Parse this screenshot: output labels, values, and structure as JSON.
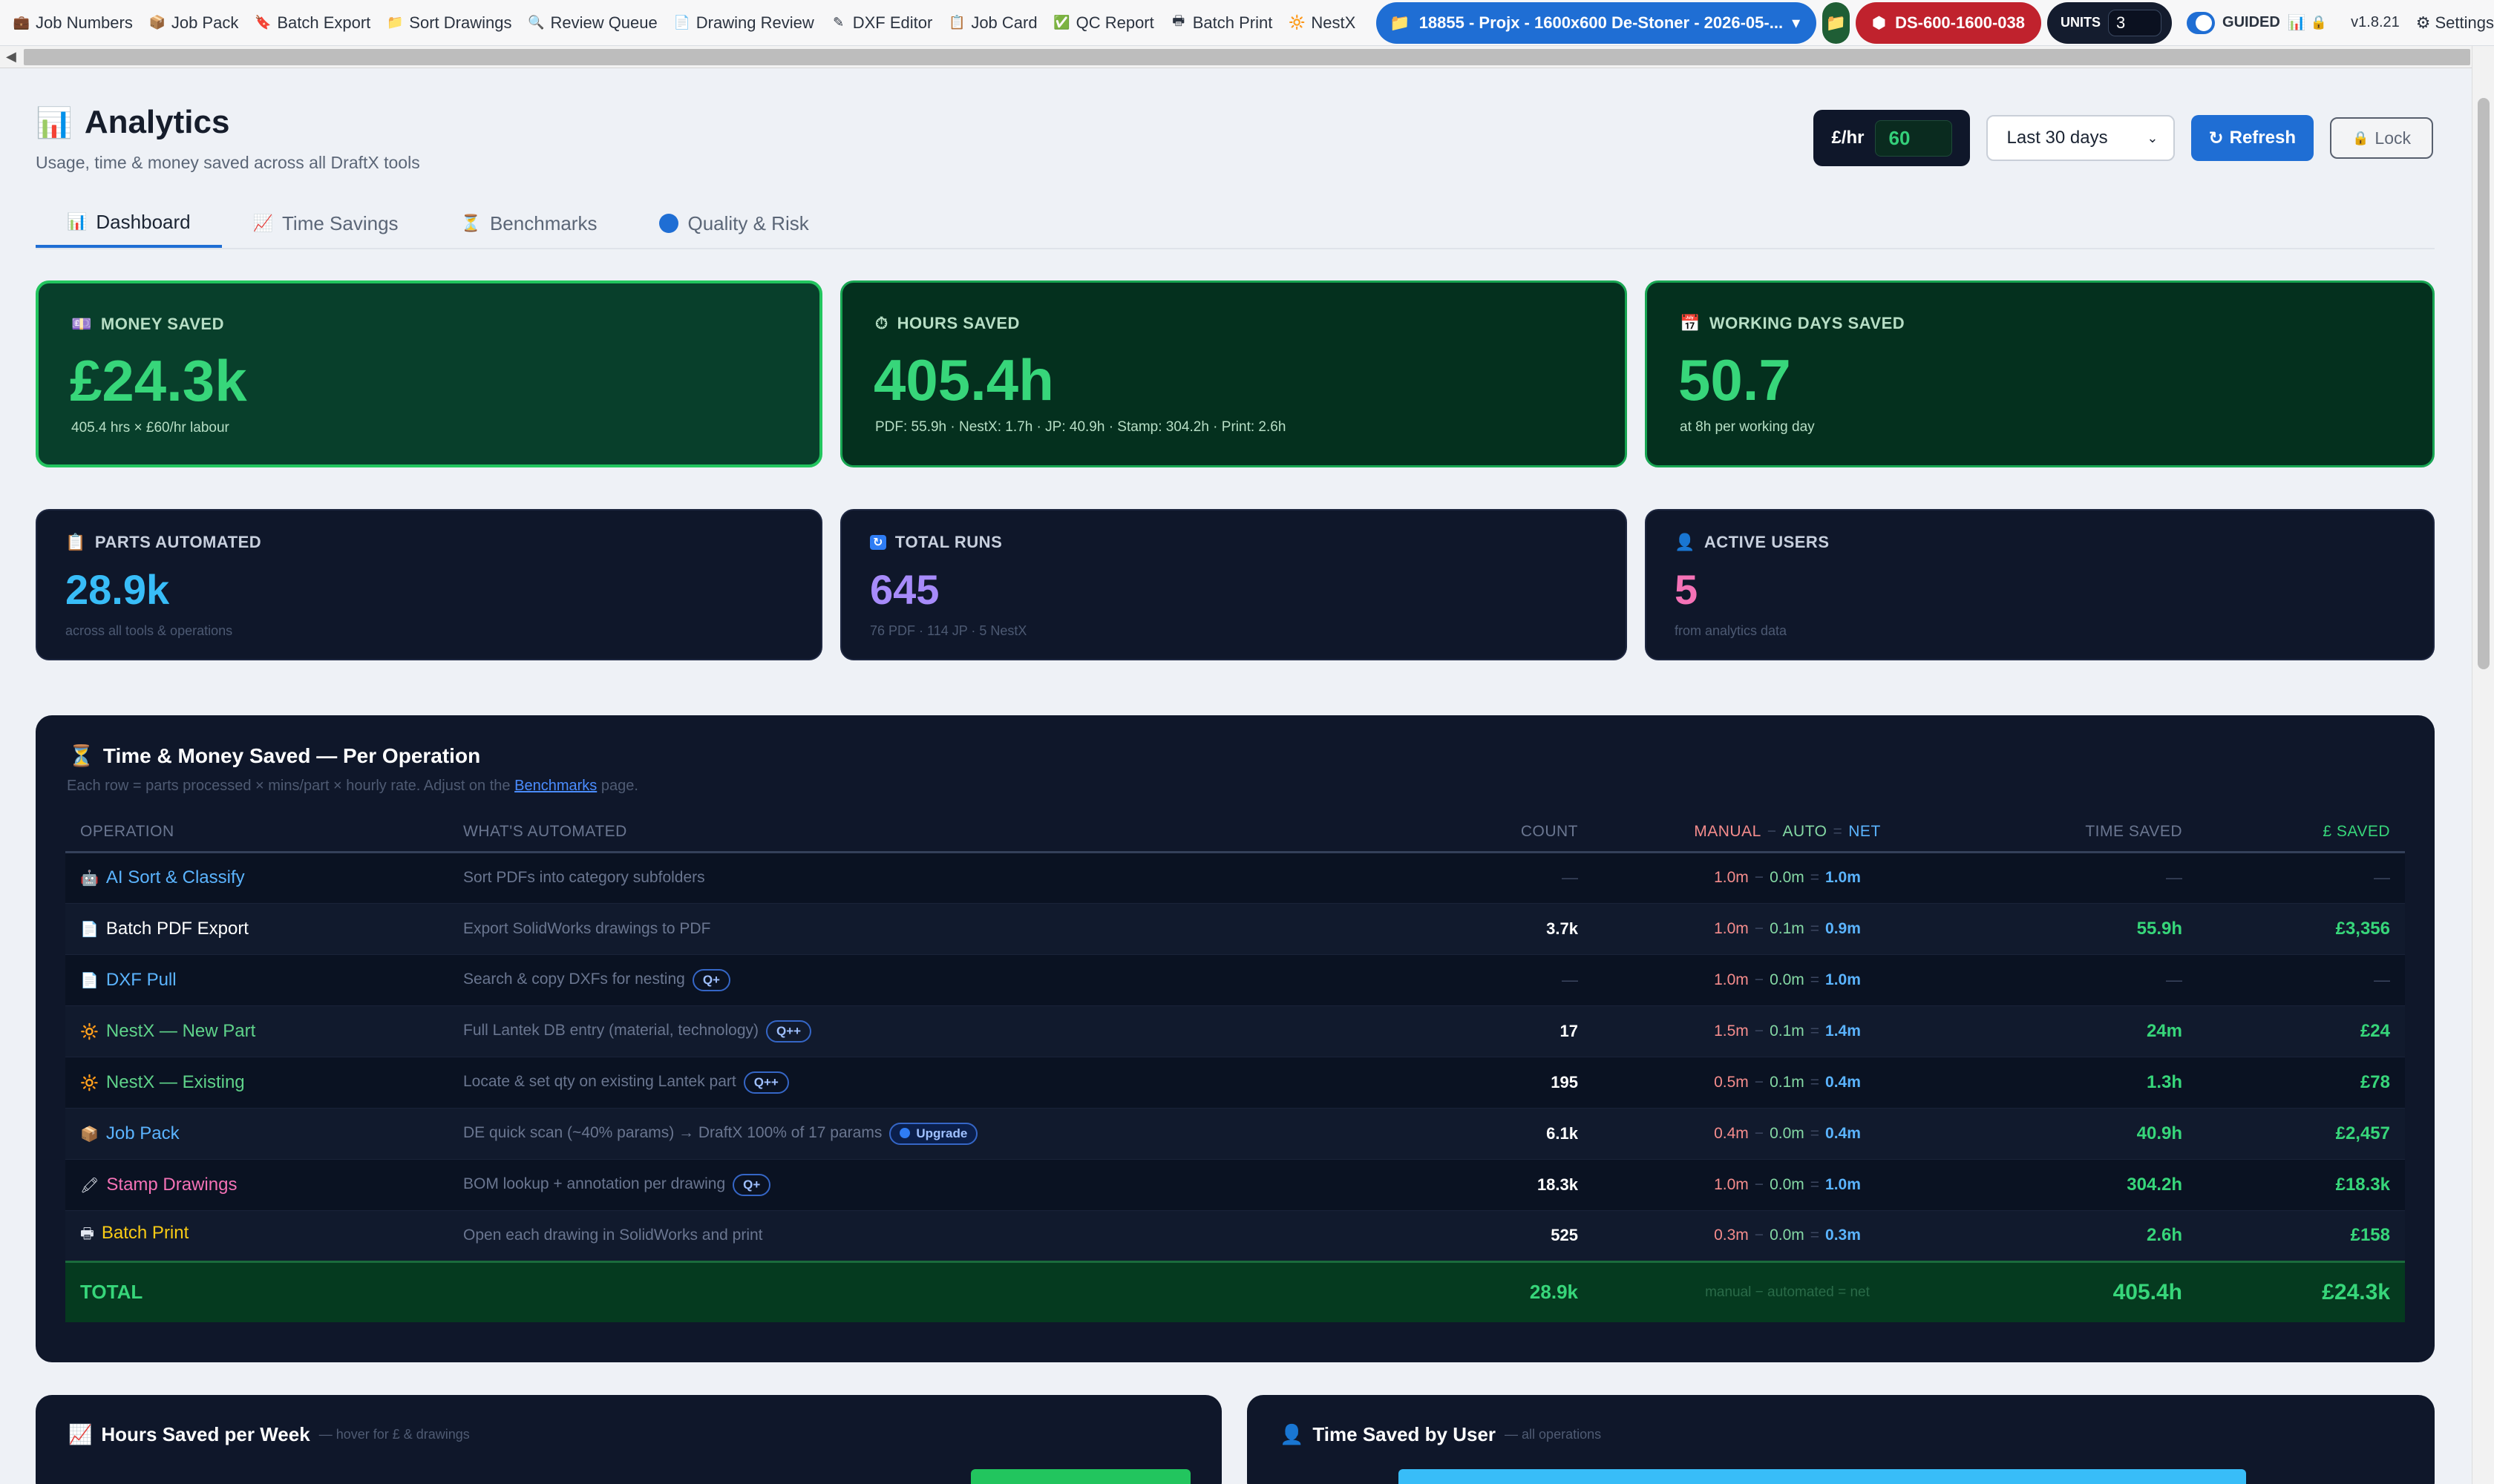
{
  "nav": [
    {
      "label": "Job Numbers",
      "icon": "briefcase-icon",
      "glyph": "💼"
    },
    {
      "label": "Job Pack",
      "icon": "package-icon",
      "glyph": "📦"
    },
    {
      "label": "Batch Export",
      "icon": "export-icon",
      "glyph": "🔖"
    },
    {
      "label": "Sort Drawings",
      "icon": "folder-icon",
      "glyph": "📁"
    },
    {
      "label": "Review Queue",
      "icon": "search-icon",
      "glyph": "🔍"
    },
    {
      "label": "Drawing Review",
      "icon": "document-icon",
      "glyph": "📄"
    },
    {
      "label": "DXF Editor",
      "icon": "pencil-icon",
      "glyph": "✎"
    },
    {
      "label": "Job Card",
      "icon": "clipboard-icon",
      "glyph": "📋"
    },
    {
      "label": "QC Report",
      "icon": "checkbox-icon",
      "glyph": "✅"
    },
    {
      "label": "Batch Print",
      "icon": "printer-icon",
      "glyph": "🖶"
    },
    {
      "label": "NestX",
      "icon": "sun-icon",
      "glyph": "🔆"
    }
  ],
  "project": {
    "label": "18855 - Projx - 1600x600 De-Stoner - 2026-05-..."
  },
  "part": {
    "label": "DS-600-1600-038"
  },
  "units": {
    "label": "UNITS",
    "value": "3"
  },
  "guided": {
    "label": "GUIDED"
  },
  "version": "v1.8.21",
  "settings": {
    "label": "Settings"
  },
  "header": {
    "title": "Analytics",
    "subtitle": "Usage, time & money saved across all DraftX tools",
    "rate_label": "£/hr",
    "rate_value": "60",
    "range": "Last 30 days",
    "refresh": "Refresh",
    "lock": "Lock"
  },
  "tabs": [
    {
      "label": "Dashboard",
      "active": true
    },
    {
      "label": "Time Savings",
      "active": false
    },
    {
      "label": "Benchmarks",
      "active": false
    },
    {
      "label": "Quality & Risk",
      "active": false
    }
  ],
  "kpi_top": [
    {
      "label": "MONEY SAVED",
      "value": "£24.3k",
      "foot": "405.4 hrs × £60/hr labour",
      "icon": "money-icon"
    },
    {
      "label": "HOURS SAVED",
      "value": "405.4h",
      "foot": "PDF: 55.9h · NestX: 1.7h · JP: 40.9h · Stamp: 304.2h · Print: 2.6h",
      "icon": "stopwatch-icon"
    },
    {
      "label": "WORKING DAYS SAVED",
      "value": "50.7",
      "foot": "at 8h per working day",
      "icon": "calendar-icon"
    }
  ],
  "kpi_bottom": [
    {
      "label": "PARTS AUTOMATED",
      "value": "28.9k",
      "foot": "across all tools & operations",
      "icon": "clipboard-icon",
      "color": "#38bdf8"
    },
    {
      "label": "TOTAL RUNS",
      "value": "645",
      "foot": "76 PDF · 114 JP · 5 NestX",
      "icon": "refresh-icon",
      "color": "#a78bfa"
    },
    {
      "label": "ACTIVE USERS",
      "value": "5",
      "foot": "from analytics data",
      "icon": "user-icon",
      "color": "#f472b6"
    }
  ],
  "ops_table": {
    "title": "Time & Money Saved — Per Operation",
    "hint_prefix": "Each row = parts processed × mins/part × hourly rate. Adjust on the",
    "hint_link": "Benchmarks",
    "hint_suffix": "page.",
    "headers": {
      "operation": "OPERATION",
      "what": "WHAT'S AUTOMATED",
      "count": "COUNT",
      "manual": "MANUAL",
      "auto": "AUTO",
      "net": "NET",
      "time": "TIME SAVED",
      "saved": "£ SAVED"
    },
    "rows": [
      {
        "op": "AI Sort & Classify",
        "icon": "robot-icon",
        "glyph": "🤖",
        "color": "#5bb4ff",
        "what": "Sort PDFs into category subfolders",
        "badge": "",
        "count": "—",
        "manual": "1.0m",
        "auto": "0.0m",
        "net": "1.0m",
        "time": "—",
        "saved": "—"
      },
      {
        "op": "Batch PDF Export",
        "icon": "document-icon",
        "glyph": "📄",
        "color": "#ffffff",
        "what": "Export SolidWorks drawings to PDF",
        "badge": "",
        "count": "3.7k",
        "manual": "1.0m",
        "auto": "0.1m",
        "net": "0.9m",
        "time": "55.9h",
        "saved": "£3,356"
      },
      {
        "op": "DXF Pull",
        "icon": "document-icon",
        "glyph": "📄",
        "color": "#5bb4ff",
        "what": "Search & copy DXFs for nesting",
        "badge": "Q+",
        "count": "—",
        "manual": "1.0m",
        "auto": "0.0m",
        "net": "1.0m",
        "time": "—",
        "saved": "—"
      },
      {
        "op": "NestX — New Part",
        "icon": "sun-icon",
        "glyph": "🔆",
        "color": "#5fd38a",
        "what": "Full Lantek DB entry (material, technology)",
        "badge": "Q++",
        "count": "17",
        "manual": "1.5m",
        "auto": "0.1m",
        "net": "1.4m",
        "time": "24m",
        "saved": "£24"
      },
      {
        "op": "NestX — Existing",
        "icon": "sun-icon",
        "glyph": "🔆",
        "color": "#5fd38a",
        "what": "Locate & set qty on existing Lantek part",
        "badge": "Q++",
        "count": "195",
        "manual": "0.5m",
        "auto": "0.1m",
        "net": "0.4m",
        "time": "1.3h",
        "saved": "£78"
      },
      {
        "op": "Job Pack",
        "icon": "package-icon",
        "glyph": "📦",
        "color": "#5bb4ff",
        "what": "DE quick scan (~40% params) → DraftX 100% of 17 params",
        "badge": "Upgrade",
        "count": "6.1k",
        "manual": "0.4m",
        "auto": "0.0m",
        "net": "0.4m",
        "time": "40.9h",
        "saved": "£2,457"
      },
      {
        "op": "Stamp Drawings",
        "icon": "stamp-icon",
        "glyph": "🖍",
        "color": "#f472b6",
        "what": "BOM lookup + annotation per drawing",
        "badge": "Q+",
        "count": "18.3k",
        "manual": "1.0m",
        "auto": "0.0m",
        "net": "1.0m",
        "time": "304.2h",
        "saved": "£18.3k"
      },
      {
        "op": "Batch Print",
        "icon": "printer-icon",
        "glyph": "🖶",
        "color": "#facc15",
        "what": "Open each drawing in SolidWorks and print",
        "badge": "",
        "count": "525",
        "manual": "0.3m",
        "auto": "0.0m",
        "net": "0.3m",
        "time": "2.6h",
        "saved": "£158"
      }
    ],
    "total": {
      "label": "TOTAL",
      "count": "28.9k",
      "formula": "manual − automated = net",
      "time": "405.4h",
      "saved": "£24.3k"
    }
  },
  "bottom_panels": [
    {
      "title": "Hours Saved per Week",
      "sub": "— hover for £ & drawings",
      "icon": "chart-icon"
    },
    {
      "title": "Time Saved by User",
      "sub": "— all operations",
      "icon": "user-icon"
    }
  ]
}
